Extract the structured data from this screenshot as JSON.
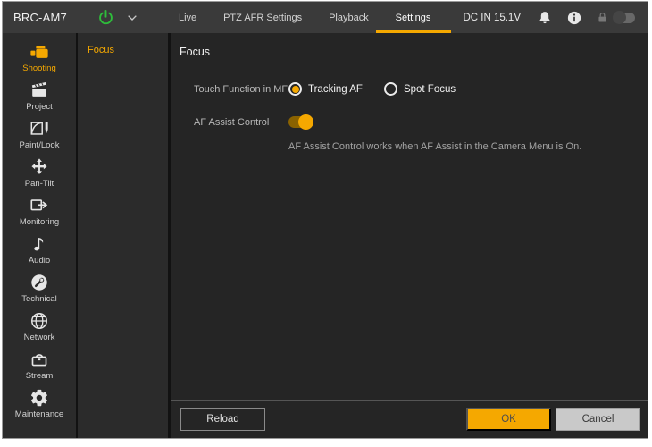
{
  "colors": {
    "accent": "#F5A800",
    "power_on": "#2EBD3B"
  },
  "topbar": {
    "device_name": "BRC-AM7",
    "power_state": "on",
    "tabs": [
      {
        "label": "Live",
        "active": false
      },
      {
        "label": "PTZ AFR Settings",
        "active": false
      },
      {
        "label": "Playback",
        "active": false
      },
      {
        "label": "Settings",
        "active": true
      }
    ],
    "power_status": "DC IN 15.1V",
    "lock_toggle_state": "off"
  },
  "sidebar": {
    "items": [
      {
        "label": "Shooting",
        "icon": "camcorder-icon",
        "active": true
      },
      {
        "label": "Project",
        "icon": "clapperboard-icon",
        "active": false
      },
      {
        "label": "Paint/Look",
        "icon": "paint-curve-icon",
        "active": false
      },
      {
        "label": "Pan-Tilt",
        "icon": "pan-tilt-arrows-icon",
        "active": false
      },
      {
        "label": "Monitoring",
        "icon": "monitor-out-icon",
        "active": false
      },
      {
        "label": "Audio",
        "icon": "music-note-icon",
        "active": false
      },
      {
        "label": "Technical",
        "icon": "wrench-circle-icon",
        "active": false
      },
      {
        "label": "Network",
        "icon": "globe-icon",
        "active": false
      },
      {
        "label": "Stream",
        "icon": "stream-box-icon",
        "active": false
      },
      {
        "label": "Maintenance",
        "icon": "gear-icon",
        "active": false
      }
    ]
  },
  "submenu": {
    "items": [
      {
        "label": "Focus",
        "active": true
      }
    ]
  },
  "main": {
    "title": "Focus",
    "touch_function": {
      "label": "Touch Function in MF",
      "options": [
        {
          "label": "Tracking AF",
          "selected": true
        },
        {
          "label": "Spot Focus",
          "selected": false
        }
      ]
    },
    "af_assist": {
      "label": "AF Assist Control",
      "state": "on",
      "note": "AF Assist Control works when AF Assist in the Camera Menu is On."
    },
    "footer": {
      "reload_label": "Reload",
      "ok_label": "OK",
      "cancel_label": "Cancel"
    }
  }
}
